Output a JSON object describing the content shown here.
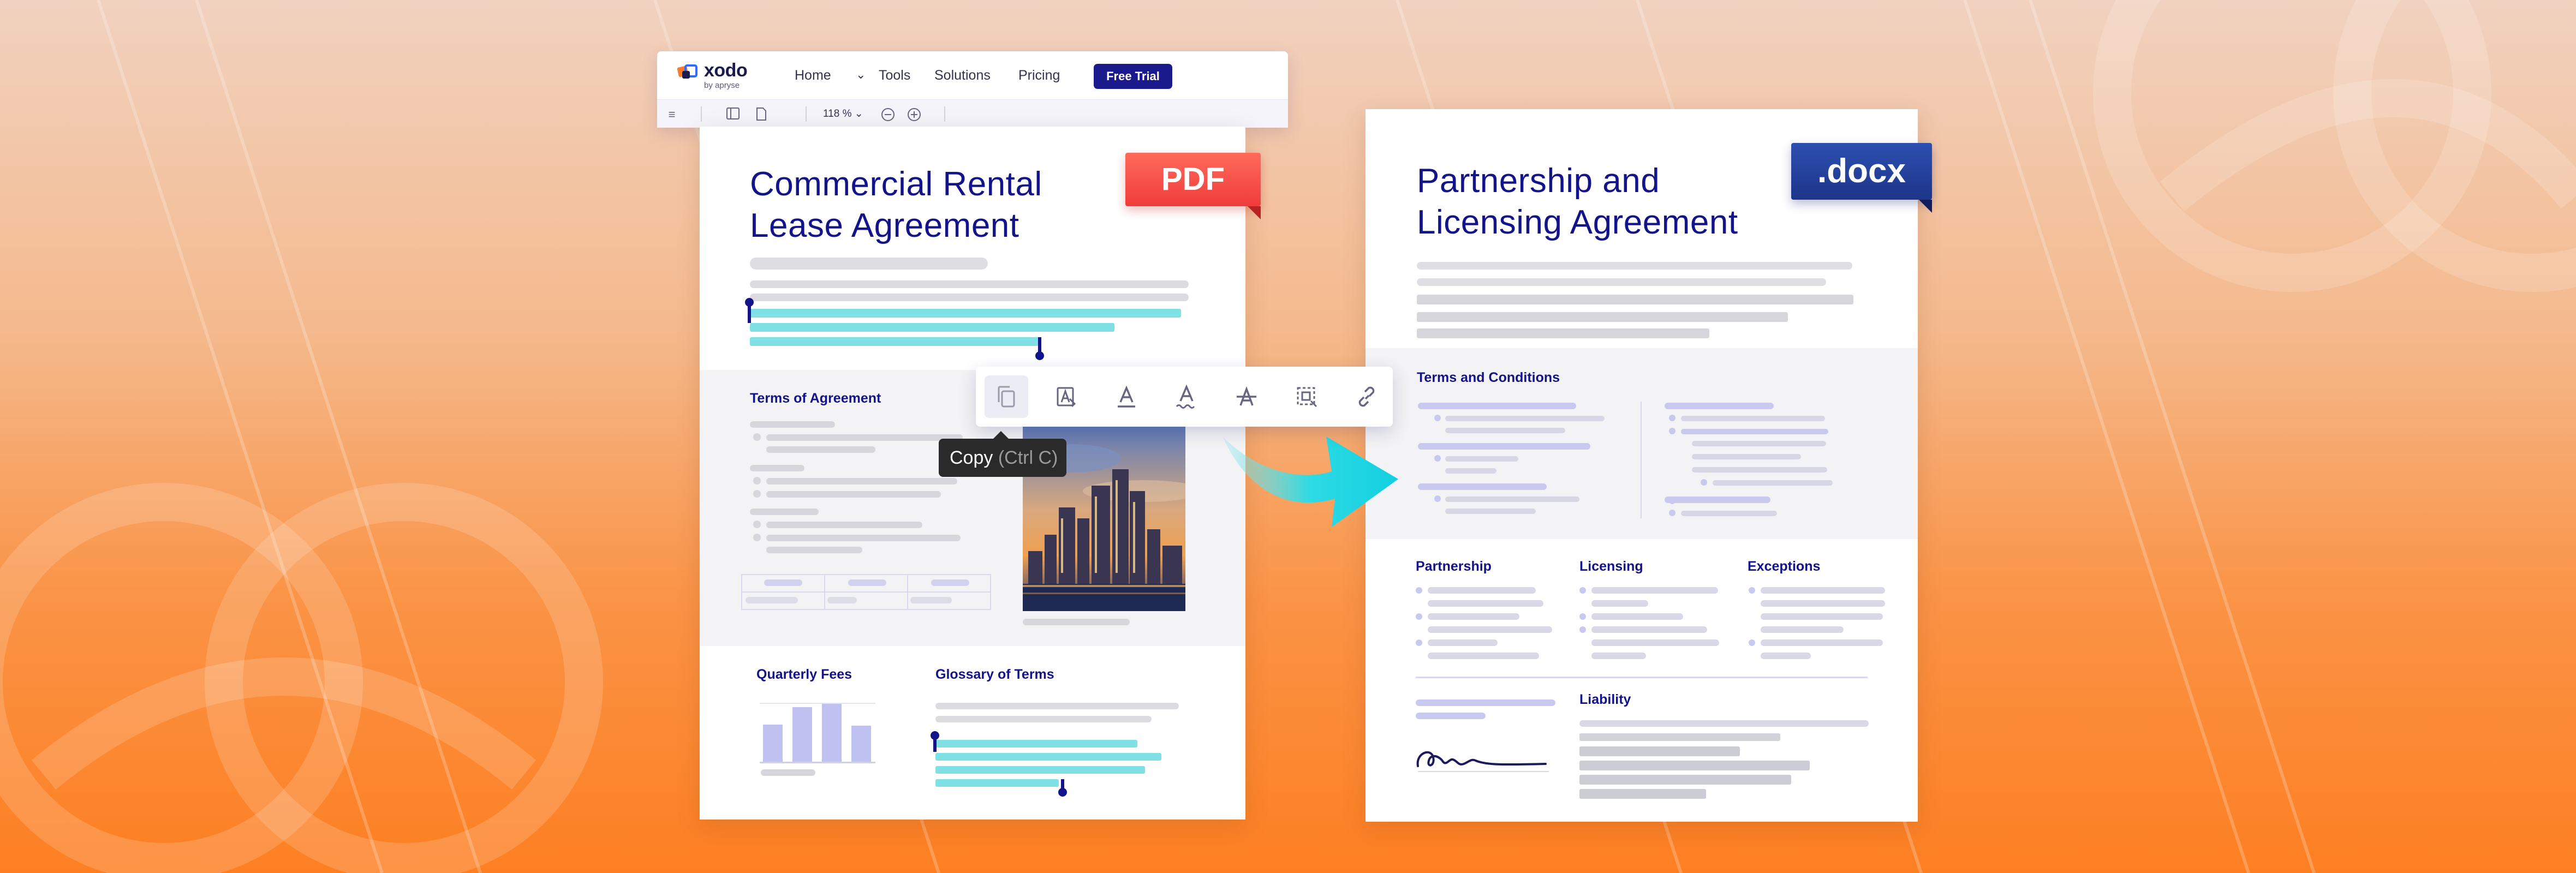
{
  "app": {
    "logo": {
      "name": "xodo",
      "sub": "by apryse"
    },
    "nav": [
      "Home",
      "Tools",
      "Solutions",
      "Pricing"
    ],
    "cta": "Free Trial",
    "zoom": "118 %"
  },
  "pdf_doc": {
    "badge": "PDF",
    "title_line1": "Commercial Rental",
    "title_line2": "Lease Agreement",
    "section1": "Terms of Agreement",
    "section2": "Quarterly Fees",
    "section3": "Glossary of Terms"
  },
  "text_toolbar": {
    "tooltip_label": "Copy",
    "tooltip_shortcut": "(Ctrl C)",
    "icons": [
      "copy-icon",
      "text-select-icon",
      "underline-icon",
      "squiggly-icon",
      "strikethrough-icon",
      "area-select-icon",
      "link-icon"
    ]
  },
  "docx_doc": {
    "badge": ".docx",
    "title_line1": "Partnership and",
    "title_line2": "Licensing Agreement",
    "section1": "Terms and Conditions",
    "col1": "Partnership",
    "col2": "Licensing",
    "col3": "Exceptions",
    "section_liability": "Liability"
  },
  "colors": {
    "brand_navy": "#14148a",
    "highlight": "#7fe0e6",
    "pdf_red": "#f03c3c",
    "docx_blue": "#1d358a",
    "arrow_cyan": "#1fd8e0"
  }
}
